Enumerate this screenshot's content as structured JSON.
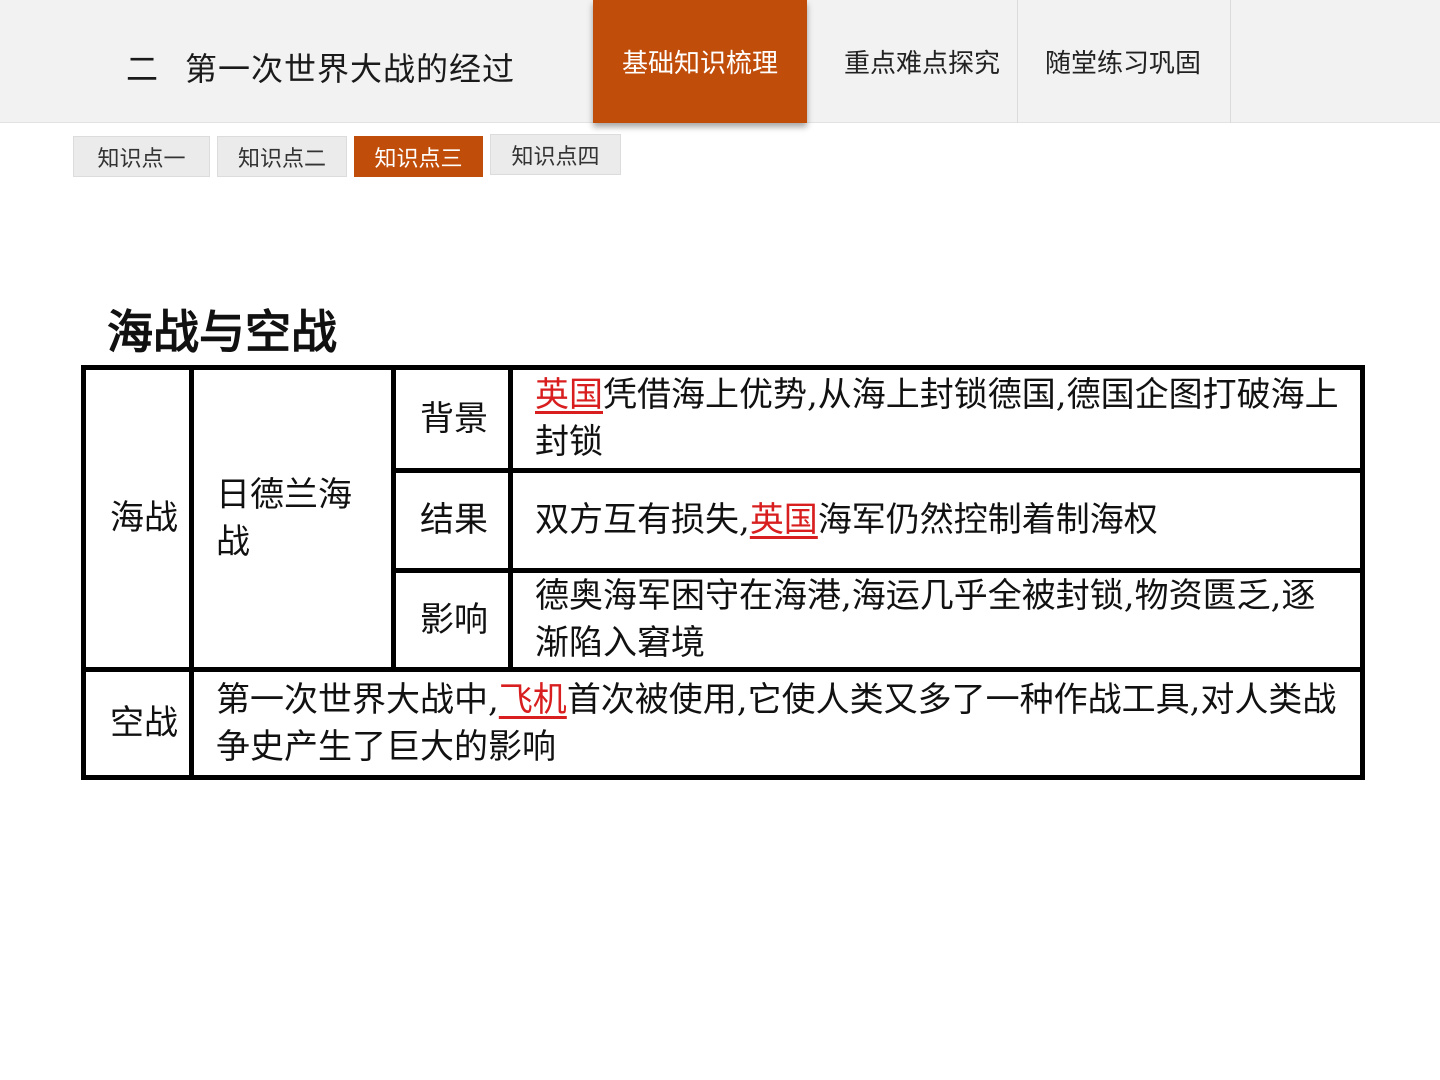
{
  "header": {
    "lesson_number": "二",
    "lesson_title": "第一次世界大战的经过",
    "tabs": [
      {
        "label": "基础知识梳理",
        "active": true
      },
      {
        "label": "重点难点探究",
        "active": false
      },
      {
        "label": "随堂练习巩固",
        "active": false
      }
    ]
  },
  "subtabs": [
    {
      "label": "知识点一",
      "active": false
    },
    {
      "label": "知识点二",
      "active": false
    },
    {
      "label": "知识点三",
      "active": true
    },
    {
      "label": "知识点四",
      "active": false
    }
  ],
  "section_heading": "海战与空战",
  "table": {
    "sea": {
      "category": "海战",
      "battle": "日德兰海战",
      "rows": [
        {
          "label": "背景",
          "highlight": "英国",
          "text": "凭借海上优势,从海上封锁德国,德国企图打破海上封锁"
        },
        {
          "label": "结果",
          "before": "双方互有损失,",
          "highlight": "英国",
          "after": "海军仍然控制着制海权"
        },
        {
          "label": "影响",
          "text": "德奥海军困守在海港,海运几乎全被封锁,物资匮乏,逐渐陷入窘境"
        }
      ]
    },
    "air": {
      "category": "空战",
      "before": "第一次世界大战中,",
      "highlight": "飞机",
      "after": "首次被使用,它使人类又多了一种作战工具,对人类战争史产生了巨大的影响"
    }
  },
  "colors": {
    "accent": "#c04d0a",
    "highlight_text": "#d81e1e",
    "header_bg": "#f2f2f2"
  }
}
